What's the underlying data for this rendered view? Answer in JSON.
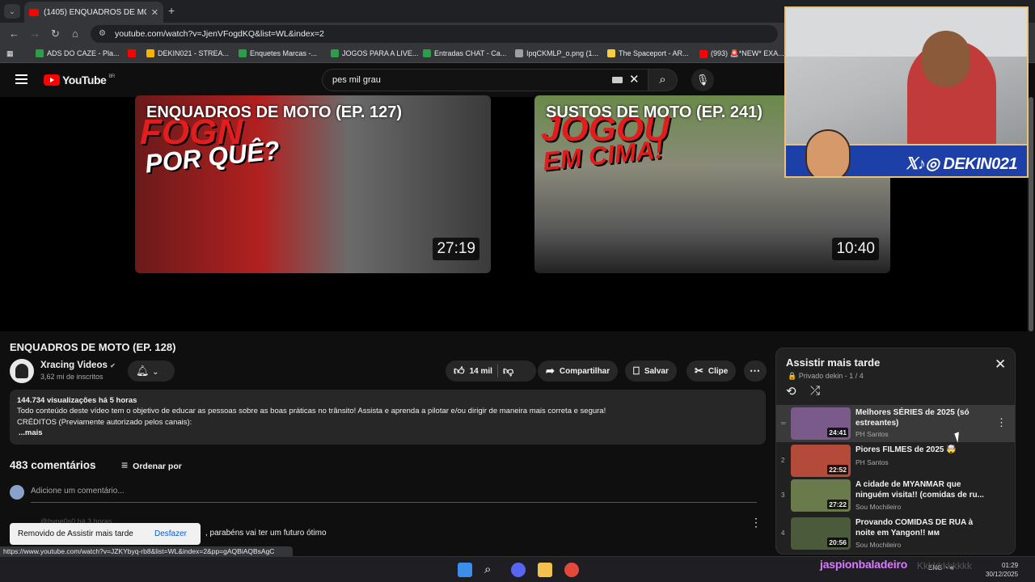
{
  "browser": {
    "tab_title": "(1405) ENQUADROS DE MOTO",
    "tab_close": "✕",
    "new_tab": "+",
    "url": "youtube.com/watch?v=JjenVFogdKQ&list=WL&index=2",
    "bookmarks": [
      {
        "label": "ADS DO CAZE - Pla...",
        "color": "#2e9d49"
      },
      {
        "label": "",
        "color": "#ff0000"
      },
      {
        "label": "DEKIN021 - STREA...",
        "color": "#f4b400"
      },
      {
        "label": "Enquetes Marcas -...",
        "color": "#2e9d49"
      },
      {
        "label": "JOGOS PARA A LIVE...",
        "color": "#2e9d49"
      },
      {
        "label": "Entradas CHAT - Ca...",
        "color": "#2e9d49"
      },
      {
        "label": "IpqCKMLP_o.png (1...",
        "color": "#9aa0a6"
      },
      {
        "label": "The Spaceport - AR...",
        "color": "#f4d03f"
      },
      {
        "label": "(993) 🚨*NEW* EXA...",
        "color": "#ff0000"
      }
    ],
    "status_url": "https://www.youtube.com/watch?v=JZKYbyq-rb8&list=WL&index=2&pp=gAQBiAQBsAgC"
  },
  "youtube": {
    "logo_text": "YouTube",
    "logo_region": "BR",
    "search_value": "pes mil grau",
    "endscreen": [
      {
        "title": "ENQUADROS DE MOTO (EP. 127)",
        "duration": "27:19",
        "overlay1": "FOGN",
        "overlay2": "POR QUÊ?"
      },
      {
        "title": "SUSTOS DE MOTO (EP. 241)",
        "duration": "10:40",
        "overlay1": "JOGOU",
        "overlay2": "EM CIMA!"
      }
    ],
    "video": {
      "title": "ENQUADROS DE MOTO (EP. 128)",
      "channel": "Xracing Videos",
      "verified": "✔",
      "subscribers": "3,62 mi de inscritos",
      "likes": "14 mil",
      "share": "Compartilhar",
      "save": "Salvar",
      "clip": "Clipe",
      "views_line": "144.734 visualizações  há 5 horas",
      "desc_line1": "Todo conteúdo deste vídeo tem o objetivo de educar as pessoas sobre as boas práticas no trânsito! Assista e aprenda a pilotar e/ou dirigir de maneira mais correta e segura!",
      "desc_line2": "CRÉDITOS (Previamente autorizado pelos canais):",
      "desc_more": "...mais"
    },
    "comments": {
      "count": "483 comentários",
      "sort": "Ordenar por",
      "placeholder": "Adicione um comentário...",
      "first_comment_tail": ", parabéns vai ter um futuro ótimo",
      "first_comment_author": "@hyne0s0 há 3 horas"
    },
    "toast": {
      "text": "Removido de Assistir mais tarde",
      "action": "Desfazer"
    },
    "playlist": {
      "title": "Assistir mais tarde",
      "subtitle": "🔒 Privado dekin - 1 / 4",
      "items": [
        {
          "index": "═",
          "title": "Melhores SÉRIES de 2025 (só estreantes)",
          "channel": "PH Santos",
          "duration": "24:41",
          "color": "#7a5a8a"
        },
        {
          "index": "2",
          "title": "Piores FILMES de 2025 🤯",
          "channel": "PH Santos",
          "duration": "22:52",
          "color": "#b34a3a"
        },
        {
          "index": "3",
          "title": "A cidade de MYANMAR que ninguém visita!! (comidas de ru...",
          "channel": "Sou Mochileiro",
          "duration": "27:22",
          "color": "#6a7a4a"
        },
        {
          "index": "4",
          "title": "Provando COMIDAS DE RUA à noite em Yangon!! ᴍᴍ",
          "channel": "Sou Mochileiro",
          "duration": "20:56",
          "color": "#4a5a3a"
        }
      ]
    }
  },
  "stream": {
    "socials": "𝕏♪◎ DEKIN021",
    "bottom_name": "jaspionbaladeiro",
    "bottom_tail": "Kkkkkkkkkkk"
  },
  "taskbar": {
    "lang": "ENG",
    "time": "01:29",
    "date": "30/12/2025"
  }
}
